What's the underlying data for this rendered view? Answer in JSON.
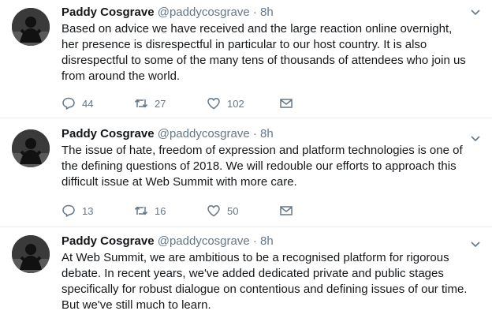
{
  "tweets": [
    {
      "name": "Paddy Cosgrave",
      "handle": "@paddycosgrave",
      "dot": "·",
      "time": "8h",
      "text": "Based on advice we have received and the large reaction online overnight, her presence is disrespectful in particular to our host country. It is also disrespectful to some of the many tens of thousands of attendees who join us from around the world.",
      "replies": "44",
      "retweets": "27",
      "likes": "102"
    },
    {
      "name": "Paddy Cosgrave",
      "handle": "@paddycosgrave",
      "dot": "·",
      "time": "8h",
      "text": "The issue of hate, freedom of expression and platform technologies is one of the defining questions of 2018. We will redouble our efforts to approach this difficult issue at Web Summit with more care.",
      "replies": "13",
      "retweets": "16",
      "likes": "50"
    },
    {
      "name": "Paddy Cosgrave",
      "handle": "@paddycosgrave",
      "dot": "·",
      "time": "8h",
      "text": "At Web Summit, we are ambitious to be a recognised platform for rigorous debate. In recent years, we've added dedicated private and public stages specifically for robust dialogue on contentious and defining issues of our time. But we've still much to learn."
    }
  ],
  "icons": {
    "reply": "reply-icon",
    "retweet": "retweet-icon",
    "like": "heart-icon",
    "message": "envelope-icon",
    "menu": "chevron-down-icon"
  },
  "colors": {
    "icon_gray": "#657786",
    "text": "#14171a",
    "divider": "#e6ecf0"
  }
}
